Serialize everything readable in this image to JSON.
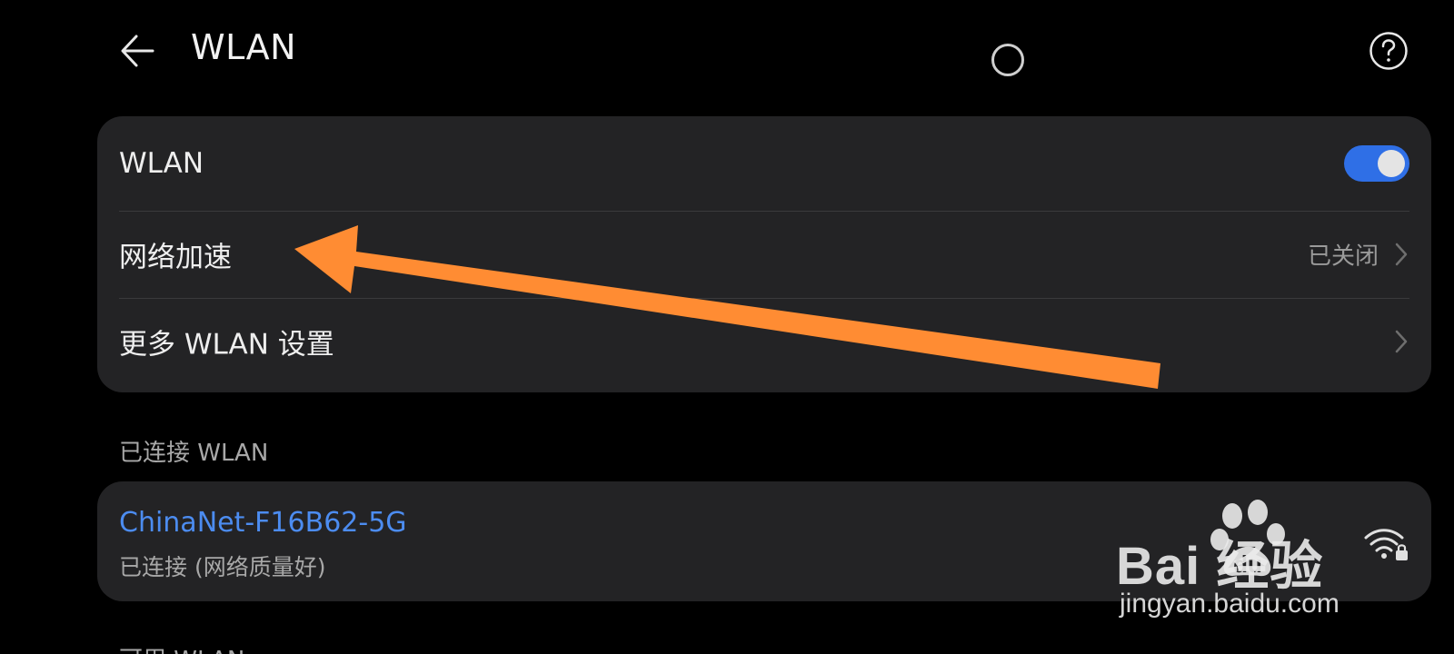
{
  "header": {
    "title": "WLAN"
  },
  "settings": {
    "wlan_label": "WLAN",
    "wlan_enabled": true,
    "net_accel_label": "网络加速",
    "net_accel_value": "已关闭",
    "more_settings_label": "更多 WLAN 设置"
  },
  "connected": {
    "section_title": "已连接 WLAN",
    "network_name": "ChinaNet-F16B62-5G",
    "network_status": "已连接 (网络质量好)"
  },
  "available": {
    "section_title": "可用 WLAN"
  },
  "watermark": {
    "brand": "Bai  经验",
    "url": "jingyan.baidu.com"
  },
  "colors": {
    "background": "#000000",
    "card": "#232325",
    "accent": "#2f6fe6",
    "link": "#4c8cf0",
    "annotation": "#ff8c33"
  },
  "icons": {
    "back": "back-arrow-icon",
    "help": "help-circle-icon",
    "chevron": "chevron-right-icon",
    "wifi": "wifi-lock-icon"
  }
}
